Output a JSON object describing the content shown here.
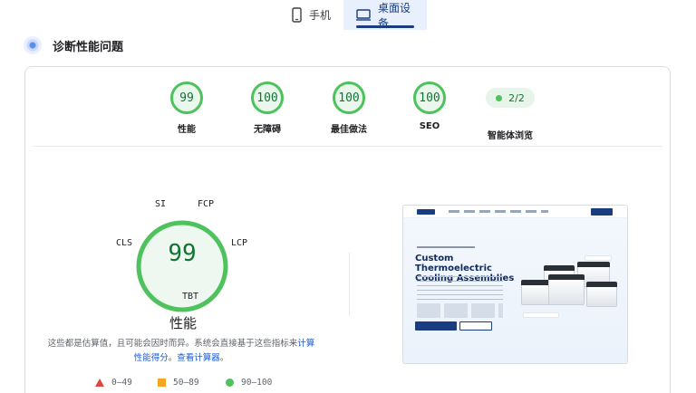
{
  "device_tabs": [
    {
      "label": "手机",
      "icon": "phone-icon",
      "active": false
    },
    {
      "label": "桌面设备",
      "icon": "desktop-icon",
      "active": true
    }
  ],
  "diagnostics": {
    "title": "诊断性能问题",
    "icon": "pulse-icon"
  },
  "category_gauges": [
    {
      "score": "99",
      "label": "性能"
    },
    {
      "score": "100",
      "label": "无障碍"
    },
    {
      "score": "100",
      "label": "最佳做法"
    },
    {
      "score": "100",
      "label": "SEO"
    }
  ],
  "agent_browsing": {
    "badge": "2/2",
    "label": "智能体浏览"
  },
  "performance": {
    "score": "99",
    "label": "性能",
    "metrics": {
      "si": "SI",
      "fcp": "FCP",
      "lcp": "LCP",
      "tbt": "TBT",
      "cls": "CLS"
    },
    "note_text": "这些都是估算值，且可能会因时而异。系统会直接基于这些指标来",
    "note_link1": "计算性能得分",
    "note_mid": "。",
    "note_link2": "查看计算器",
    "note_end": "。"
  },
  "legend": {
    "fail": "0–49",
    "average": "50–89",
    "pass": "90–100"
  },
  "colors": {
    "pass": "#4ec25c",
    "average": "#f5a623",
    "fail": "#e0463d",
    "accent": "#1a3c80",
    "link": "#1a5bd8"
  },
  "screenshot": {
    "headline": "Custom Thermoelectric Cooling Assemblies"
  }
}
